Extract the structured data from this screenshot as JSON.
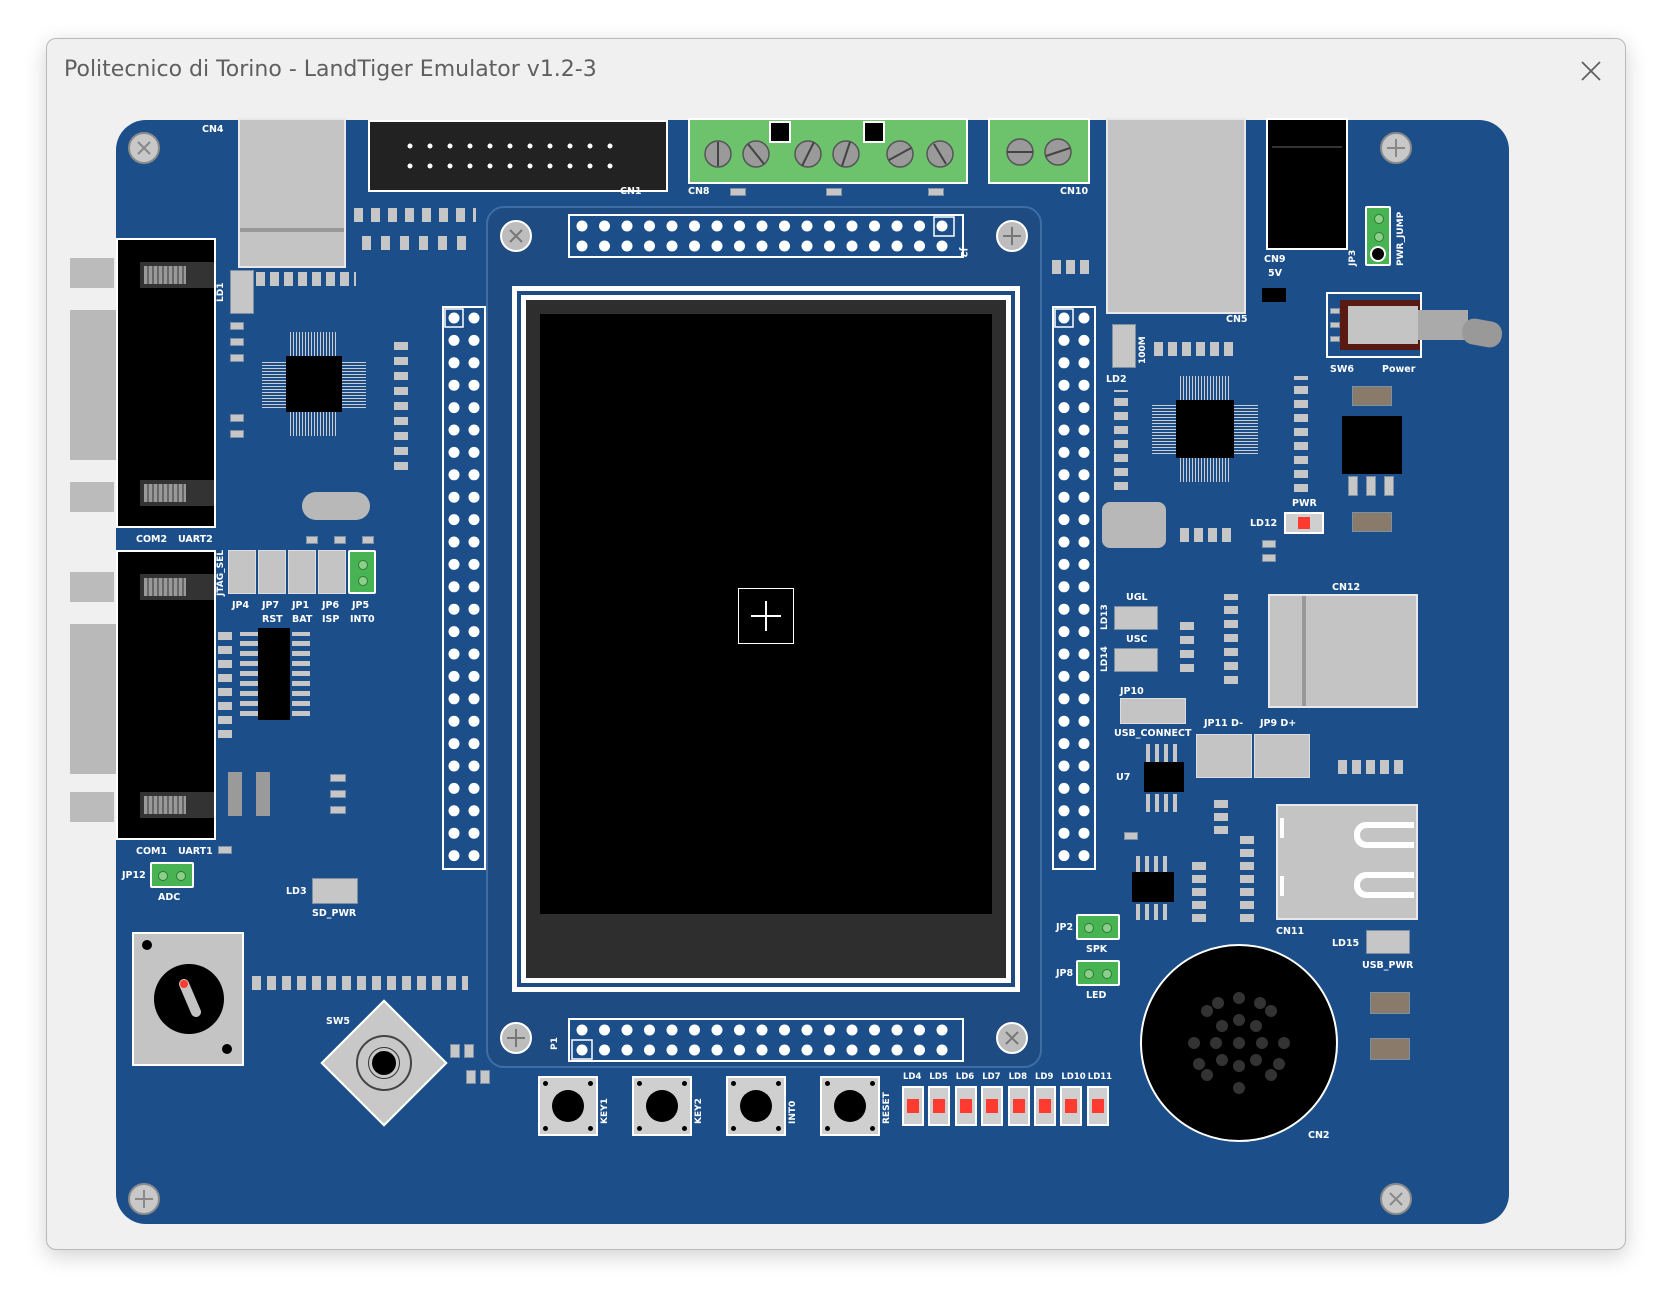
{
  "window": {
    "title": "Politecnico di Torino - LandTiger Emulator v1.2-3",
    "close_glyph": "✕"
  },
  "board": {
    "colors": {
      "pcb": "#1c4f8a",
      "connector_green": "#6cc36c",
      "led_red": "#ff3b30",
      "lcd": "#000000"
    },
    "labels": {
      "cn4": "CN4",
      "cn1": "CN1",
      "cn8": "CN8",
      "cn10": "CN10",
      "j2": "J2",
      "cn9": "CN9",
      "cn9_5v": "5V",
      "jp3": "JP3",
      "pwr_jump": "PWR_JUMP",
      "cn5": "CN5",
      "sw6": "SW6",
      "power": "Power",
      "ld1": "LD1",
      "ld2": "LD2",
      "r100m": "100M",
      "com2": "COM2",
      "uart2": "UART2",
      "com1": "COM1",
      "uart1": "UART1",
      "jtag_sel": "JTAG_SEL",
      "jp4": "JP4",
      "jp7": "JP7",
      "jp1": "JP1",
      "jp6": "JP6",
      "jp5": "JP5",
      "rst": "RST",
      "bat": "BAT",
      "isp": "ISP",
      "int0": "INT0",
      "jp12": "JP12",
      "adc": "ADC",
      "ld3": "LD3",
      "sd_pwr": "SD_PWR",
      "sw5": "SW5",
      "p1": "P1",
      "pwr": "PWR",
      "ld12": "LD12",
      "cn12": "CN12",
      "ugl": "UGL",
      "usc": "USC",
      "ld13": "LD13",
      "ld14": "LD14",
      "jp10": "JP10",
      "usb_connect": "USB_CONNECT",
      "jp11": "JP11 D-",
      "jp9": "JP9 D+",
      "u7": "U7",
      "cn11": "CN11",
      "ld15": "LD15",
      "usb_pwr": "USB_PWR",
      "jp2": "JP2",
      "spk": "SPK",
      "jp8": "JP8",
      "led": "LED",
      "cn2": "CN2"
    },
    "buttons": [
      {
        "id": "key1",
        "label": "KEY1"
      },
      {
        "id": "key2",
        "label": "KEY2"
      },
      {
        "id": "int0",
        "label": "INT0"
      },
      {
        "id": "reset",
        "label": "RESET"
      }
    ],
    "leds": [
      "LD4",
      "LD5",
      "LD6",
      "LD7",
      "LD8",
      "LD9",
      "LD10",
      "LD11"
    ],
    "lcd": {
      "cursor": "crosshair"
    }
  }
}
